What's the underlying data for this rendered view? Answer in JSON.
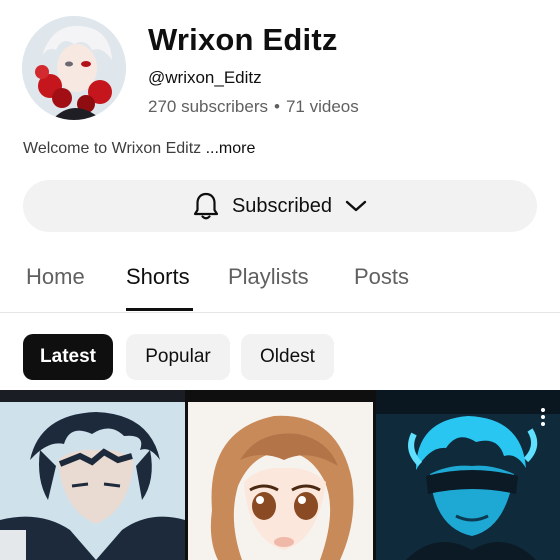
{
  "channel": {
    "name": "Wrixon Editz",
    "handle": "@wrixon_Editz",
    "subscribers": "270 subscribers",
    "separator": "•",
    "videos": "71 videos",
    "description": "Welcome to Wrixon Editz",
    "more_label": "...more"
  },
  "subscribe_button": {
    "label": "Subscribed",
    "icon": "bell-icon",
    "dropdown_icon": "chevron-down-icon"
  },
  "tabs": [
    {
      "label": "Home",
      "active": false
    },
    {
      "label": "Shorts",
      "active": true
    },
    {
      "label": "Playlists",
      "active": false
    },
    {
      "label": "Posts",
      "active": false
    }
  ],
  "sort_chips": [
    {
      "label": "Latest",
      "selected": true
    },
    {
      "label": "Popular",
      "selected": false
    },
    {
      "label": "Oldest",
      "selected": false
    }
  ],
  "shorts": [
    {
      "thumbnail": "anime-boy-dark-hair"
    },
    {
      "thumbnail": "anime-girl-brown-hair"
    },
    {
      "thumbnail": "anime-boy-blue-glow",
      "menu_icon": "more-vert-icon"
    }
  ],
  "colors": {
    "text_primary": "#0f0f0f",
    "text_secondary": "#606060",
    "chip_bg": "#f2f2f2",
    "chip_selected_bg": "#0f0f0f",
    "button_bg": "#f2f2f2"
  }
}
